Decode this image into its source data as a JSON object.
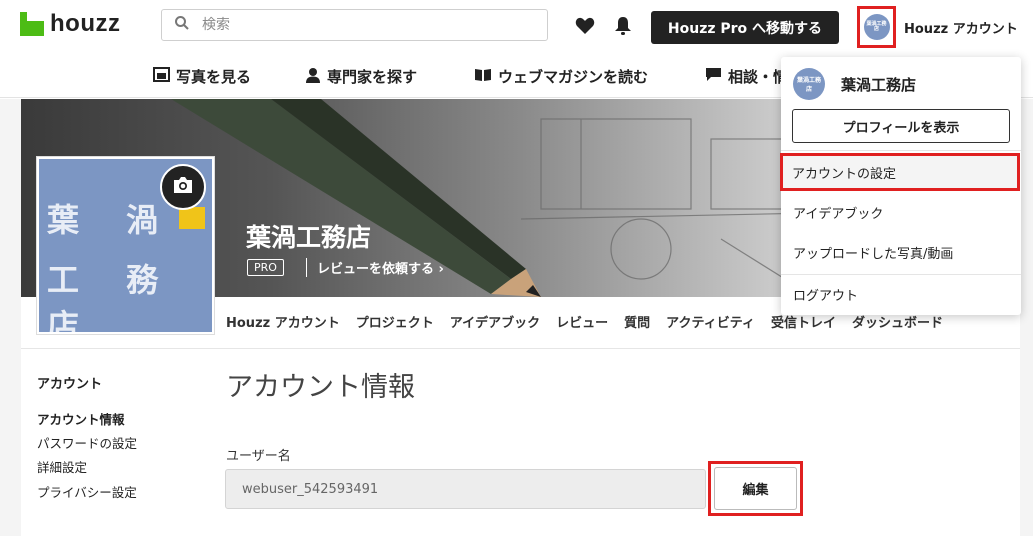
{
  "header": {
    "logo_text": "houzz",
    "search_placeholder": "検索",
    "pro_button": "Houzz Pro へ移動する",
    "account_label": "Houzz アカウント",
    "avatar_text": "葉渦工務店"
  },
  "nav": [
    {
      "label": "写真を見る",
      "icon": "photo-icon"
    },
    {
      "label": "専門家を探す",
      "icon": "person-icon"
    },
    {
      "label": "ウェブマガジンを読む",
      "icon": "book-icon"
    },
    {
      "label": "相談・情",
      "icon": "chat-icon"
    }
  ],
  "profile": {
    "business_name": "葉渦工務店",
    "pro_tag": "PRO",
    "review_link": "レビューを依頼する",
    "picture_line1": "葉 渦",
    "picture_line2": "工 務 店"
  },
  "subtabs": [
    "Houzz アカウント",
    "プロジェクト",
    "アイデアブック",
    "レビュー",
    "質問",
    "アクティビティ",
    "受信トレイ",
    "ダッシュボード"
  ],
  "sidebar": {
    "heading": "アカウント",
    "items": [
      "アカウント情報",
      "パスワードの設定",
      "詳細設定",
      "プライバシー設定"
    ]
  },
  "main": {
    "title": "アカウント情報",
    "username_label": "ユーザー名",
    "username_value": "webuser_542593491",
    "edit_button": "編集"
  },
  "dropdown": {
    "username": "葉渦工務店",
    "profile_button": "プロフィールを表示",
    "items": [
      "アカウントの設定",
      "アイデアブック",
      "アップロードした写真/動画",
      "ログアウト"
    ]
  },
  "colors": {
    "brand_green": "#4dbc15",
    "highlight_red": "#e02020",
    "avatar_blue": "#7c96c3",
    "dark_button": "#222222"
  }
}
